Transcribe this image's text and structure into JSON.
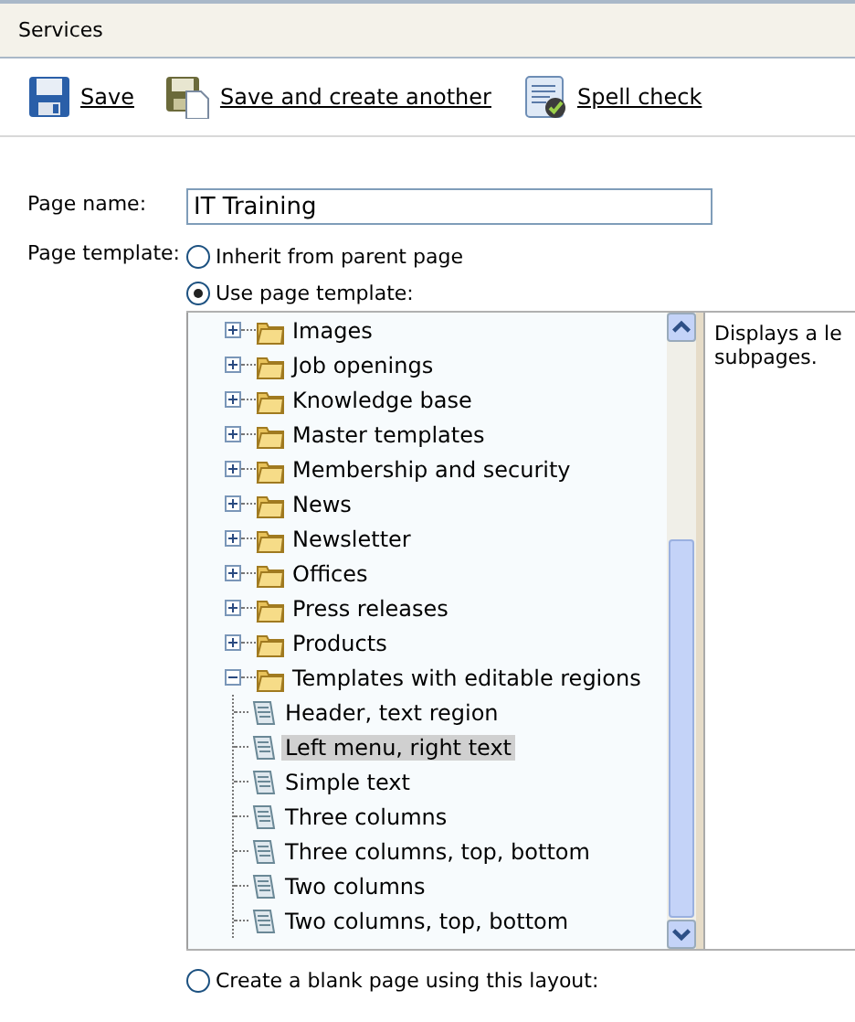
{
  "header": {
    "title": "Services"
  },
  "toolbar": [
    {
      "label": "Save",
      "kind": "save"
    },
    {
      "label": "Save and create another",
      "kind": "save-new"
    },
    {
      "label": "Spell check",
      "kind": "spell"
    }
  ],
  "page_name": {
    "label": "Page name:",
    "value": "IT Training"
  },
  "page_template": {
    "label": "Page template:",
    "options": [
      {
        "label": "Inherit from parent page",
        "selected": false
      },
      {
        "label": "Use page template:",
        "selected": true
      }
    ],
    "tree": [
      {
        "label": "Images",
        "expanded": false,
        "selected": false
      },
      {
        "label": "Job openings",
        "expanded": false,
        "selected": false
      },
      {
        "label": "Knowledge base",
        "expanded": false,
        "selected": false
      },
      {
        "label": "Master templates",
        "expanded": false,
        "selected": false
      },
      {
        "label": "Membership and security",
        "expanded": false,
        "selected": false
      },
      {
        "label": "News",
        "expanded": false,
        "selected": false
      },
      {
        "label": "Newsletter",
        "expanded": false,
        "selected": false
      },
      {
        "label": "Offices",
        "expanded": false,
        "selected": false
      },
      {
        "label": "Press releases",
        "expanded": false,
        "selected": false
      },
      {
        "label": "Products",
        "expanded": false,
        "selected": false
      },
      {
        "label": "Templates with editable regions",
        "expanded": true,
        "selected": false,
        "children": [
          {
            "label": "Header, text region",
            "selected": false
          },
          {
            "label": "Left menu, right text",
            "selected": true
          },
          {
            "label": "Simple text",
            "selected": false
          },
          {
            "label": "Three columns",
            "selected": false
          },
          {
            "label": "Three columns, top, bottom",
            "selected": false
          },
          {
            "label": "Two columns",
            "selected": false
          },
          {
            "label": "Two columns, top, bottom",
            "selected": false
          }
        ]
      }
    ],
    "description": [
      "Displays a le",
      "subpages."
    ],
    "blank_option": {
      "label": "Create a blank page using this layout:",
      "selected": false
    }
  }
}
